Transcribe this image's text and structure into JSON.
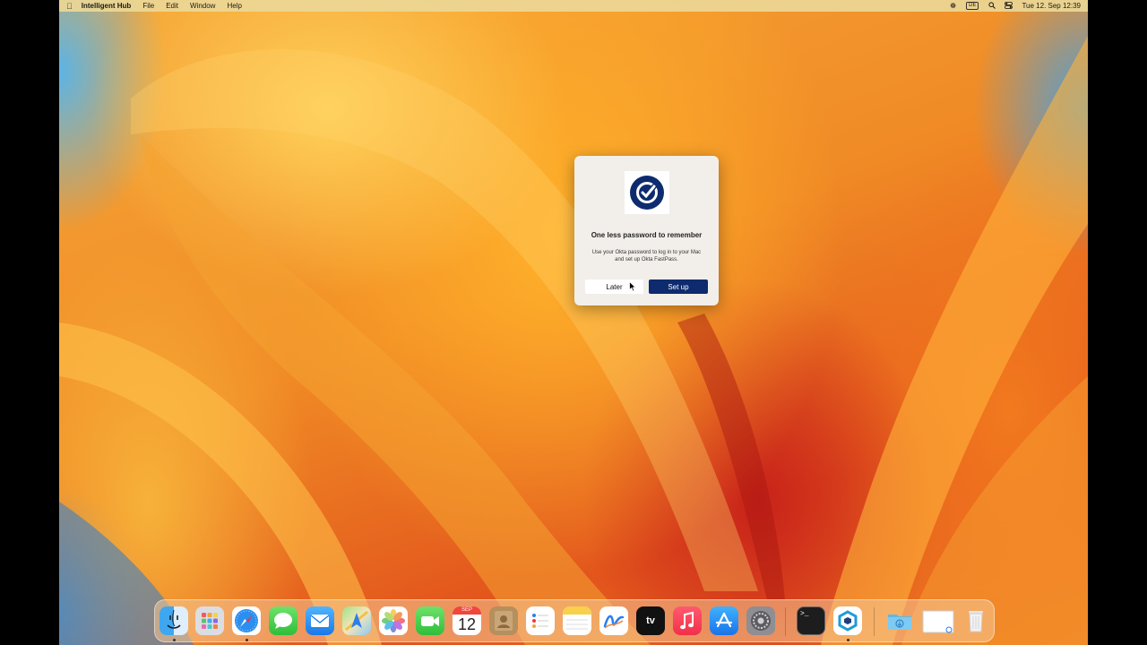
{
  "menubar": {
    "app_name": "Intelligent Hub",
    "menus": [
      "File",
      "Edit",
      "Window",
      "Help"
    ],
    "input_source": "DE",
    "datetime": "Tue 12. Sep  12:39"
  },
  "dialog": {
    "title": "One less password to remember",
    "body": "Use your Okta password to log in to your Mac and set up Okta FastPass.",
    "later_label": "Later",
    "setup_label": "Set up",
    "accent_color": "#0d2b6e"
  },
  "dock": {
    "apps": [
      {
        "name": "finder-icon",
        "running": true
      },
      {
        "name": "launchpad-icon",
        "running": false
      },
      {
        "name": "safari-icon",
        "running": true
      },
      {
        "name": "messages-icon",
        "running": false
      },
      {
        "name": "mail-icon",
        "running": false
      },
      {
        "name": "maps-icon",
        "running": false
      },
      {
        "name": "photos-icon",
        "running": false
      },
      {
        "name": "facetime-icon",
        "running": false
      },
      {
        "name": "calendar-icon",
        "running": false
      },
      {
        "name": "contacts-icon",
        "running": false
      },
      {
        "name": "reminders-icon",
        "running": false
      },
      {
        "name": "notes-icon",
        "running": false
      },
      {
        "name": "freeform-icon",
        "running": false
      },
      {
        "name": "apple-tv-icon",
        "running": false
      },
      {
        "name": "music-icon",
        "running": false
      },
      {
        "name": "app-store-icon",
        "running": false
      },
      {
        "name": "system-settings-icon",
        "running": false
      },
      {
        "name": "terminal-icon",
        "running": false
      },
      {
        "name": "intelligent-hub-icon",
        "running": true
      },
      {
        "name": "downloads-folder-icon",
        "running": false
      },
      {
        "name": "document-icon",
        "running": false
      },
      {
        "name": "trash-icon",
        "running": false
      }
    ],
    "calendar_month": "SEP",
    "calendar_day": "12",
    "tv_label": "tv"
  }
}
